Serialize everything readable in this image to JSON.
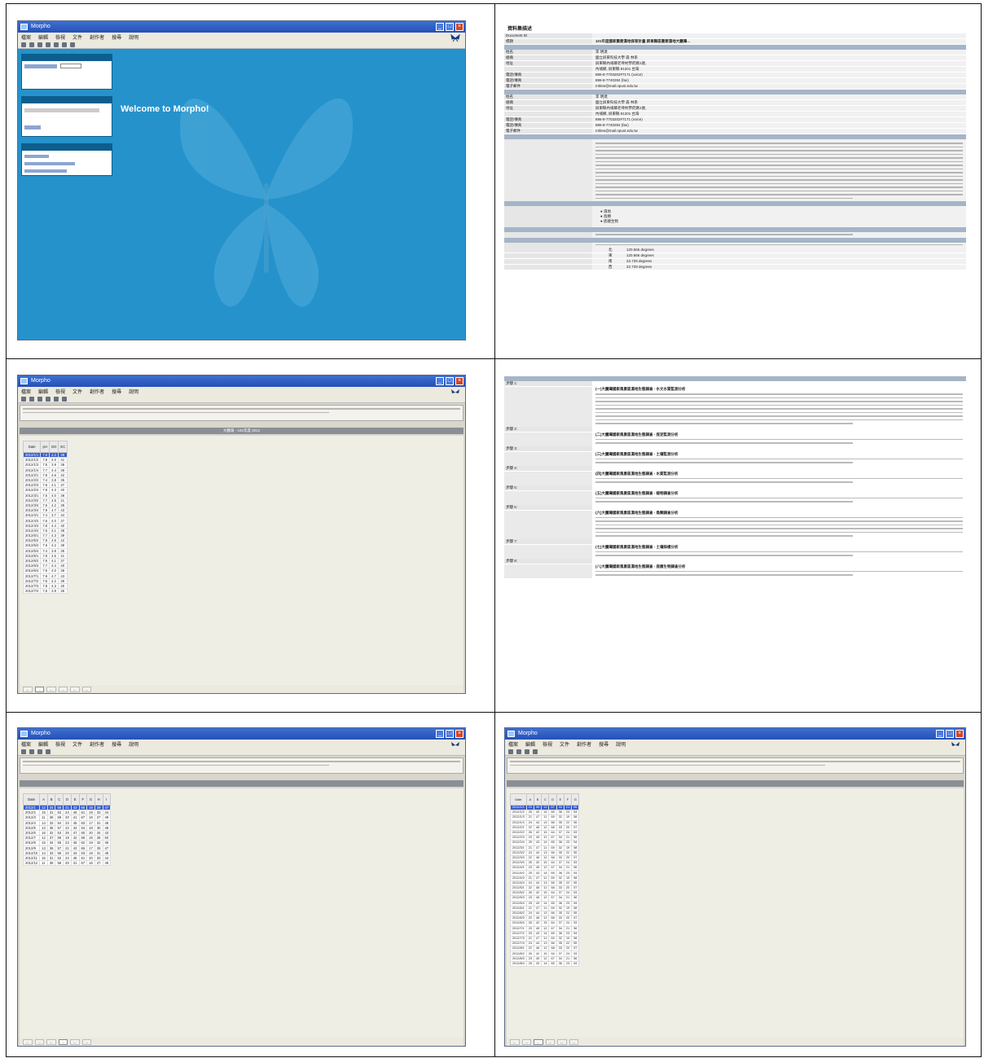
{
  "welcome": {
    "title": "Morpho",
    "menu": [
      "檔案",
      "編輯",
      "檢視",
      "文件",
      "創作者",
      "搜尋",
      "說明"
    ],
    "greeting": "Welcome to Morpho!",
    "panels": [
      {
        "header": "",
        "lines": [
          "",
          "",
          ""
        ]
      },
      {
        "header": "",
        "lines": [
          "",
          "",
          ""
        ]
      },
      {
        "header": "",
        "lines": [
          "",
          "",
          ""
        ]
      }
    ]
  },
  "doc1": {
    "title": "資料集描述",
    "fields": [
      {
        "k": "Document ID",
        "v": ""
      },
      {
        "k": "標題",
        "v": "101年度國家重要濕地保育計畫 屏東縣區重要濕地大鵬灣..."
      }
    ],
    "sections": [
      {
        "head": "",
        "rows": [
          {
            "k": "姓名",
            "v": "李 明達"
          },
          {
            "k": "組織",
            "v": "國立屏東科技大學 森 林系"
          },
          {
            "k": "地址",
            "v": "屏東縣內埔鄉老埤村學府路1號,"
          },
          {
            "k": "",
            "v": "內埔鄉, 屏東縣 91201 台灣"
          },
          {
            "k": "電話/傳真",
            "v": "886-8-7703202#7171 (voice)"
          },
          {
            "k": "電話/傳真",
            "v": "886-8-7740294 (fax)"
          },
          {
            "k": "電子郵件",
            "v": "mhlee@mail.npust.edu.tw"
          }
        ]
      },
      {
        "head": "",
        "rows": [
          {
            "k": "姓名",
            "v": "李 明達"
          },
          {
            "k": "組織",
            "v": "國立屏東科技大學 森 林系"
          },
          {
            "k": "地址",
            "v": "屏東縣內埔鄉老埤村學府路1號,"
          },
          {
            "k": "",
            "v": "內埔鄉, 屏東縣 91201 台灣"
          },
          {
            "k": "電話/傳真",
            "v": "886-8-7703202#7171 (voice)"
          },
          {
            "k": "電話/傳真",
            "v": "886-8-7740294 (fax)"
          },
          {
            "k": "電子郵件",
            "v": "mhlee@mail.npust.edu.tw"
          }
        ]
      }
    ],
    "keywords": [
      "濕地",
      "鳥類",
      "底棲生物"
    ],
    "coords": [
      {
        "k": "北",
        "v": "120.566 degrees"
      },
      {
        "k": "東",
        "v": "120.566 degrees"
      },
      {
        "k": "南",
        "v": "22.729 degrees"
      },
      {
        "k": "西",
        "v": "22.729 degrees"
      }
    ]
  },
  "doc2": {
    "steps": [
      {
        "k": "步驟 1:",
        "head": "(一)大鵬灣國家風景區濕地生態調查 - 水文水質監測分析"
      },
      {
        "k": "步驟 2:",
        "head": "(二)大鵬灣國家風景區濕地生態調查 - 底泥監測分析"
      },
      {
        "k": "步驟 3:",
        "head": "(三)大鵬灣國家風景區濕地生態調查 - 土壤監測分析"
      },
      {
        "k": "步驟 4:",
        "head": "(四)大鵬灣國家風景區濕地生態調查 - 水質監測分析"
      },
      {
        "k": "步驟 5:",
        "head": "(五)大鵬灣國家風景區濕地生態調查 - 植物調查分析"
      },
      {
        "k": "步驟 6:",
        "head": "(六)大鵬灣國家風景區濕地生態調查 - 鳥類調查分析"
      },
      {
        "k": "步驟 7:",
        "head": "(七)大鵬灣國家風景區濕地生態調查 - 土壤採樣分析"
      },
      {
        "k": "步驟 8:",
        "head": "(八)大鵬灣國家風景區濕地生態調查 - 底棲生物調查分析"
      }
    ]
  },
  "table1": {
    "title": "大鵬灣 - 101年度 2012",
    "cols": [
      "Date",
      "pH",
      "DO",
      "EC"
    ],
    "rows": [
      [
        "2012/1/1",
        "7.6",
        "4.2",
        "38"
      ],
      [
        "2012/1/2",
        "7.8",
        "4.0",
        "41"
      ],
      [
        "2012/1/3",
        "7.5",
        "3.9",
        "36"
      ],
      [
        "2012/1/4",
        "7.7",
        "4.4",
        "39"
      ],
      [
        "2012/2/1",
        "7.9",
        "4.6",
        "42"
      ],
      [
        "2012/2/2",
        "7.4",
        "3.8",
        "35"
      ],
      [
        "2012/2/3",
        "7.6",
        "4.1",
        "37"
      ],
      [
        "2012/2/4",
        "7.8",
        "4.3",
        "40"
      ],
      [
        "2012/3/1",
        "7.5",
        "4.0",
        "38"
      ],
      [
        "2012/3/2",
        "7.7",
        "4.5",
        "41"
      ],
      [
        "2012/3/3",
        "7.6",
        "4.2",
        "39"
      ],
      [
        "2012/3/4",
        "7.9",
        "4.7",
        "43"
      ],
      [
        "2012/4/1",
        "7.4",
        "3.7",
        "34"
      ],
      [
        "2012/4/2",
        "7.6",
        "4.0",
        "37"
      ],
      [
        "2012/4/3",
        "7.8",
        "4.4",
        "40"
      ],
      [
        "2012/4/4",
        "7.5",
        "4.1",
        "38"
      ],
      [
        "2012/5/1",
        "7.7",
        "4.3",
        "39"
      ],
      [
        "2012/5/2",
        "7.9",
        "4.6",
        "42"
      ],
      [
        "2012/5/3",
        "7.6",
        "4.2",
        "38"
      ],
      [
        "2012/5/4",
        "7.4",
        "3.9",
        "35"
      ],
      [
        "2012/6/1",
        "7.8",
        "4.5",
        "41"
      ],
      [
        "2012/6/2",
        "7.6",
        "4.1",
        "37"
      ],
      [
        "2012/6/3",
        "7.7",
        "4.4",
        "40"
      ],
      [
        "2012/6/4",
        "7.5",
        "4.0",
        "36"
      ],
      [
        "2012/7/1",
        "7.9",
        "4.7",
        "43"
      ],
      [
        "2012/7/2",
        "7.6",
        "4.2",
        "39"
      ],
      [
        "2012/7/3",
        "7.8",
        "4.3",
        "40"
      ],
      [
        "2012/7/4",
        "7.5",
        "3.9",
        "36"
      ]
    ]
  },
  "table2": {
    "cols": [
      "Date",
      "A",
      "B",
      "C",
      "D",
      "E",
      "F",
      "G",
      "H",
      "I"
    ],
    "rows": [
      [
        "2012/1",
        "12",
        "34",
        "56",
        "21",
        "43",
        "65",
        "18",
        "29",
        "47"
      ],
      [
        "2012/2",
        "15",
        "31",
        "52",
        "24",
        "46",
        "61",
        "19",
        "33",
        "44"
      ],
      [
        "2012/3",
        "11",
        "36",
        "58",
        "20",
        "41",
        "67",
        "16",
        "27",
        "49"
      ],
      [
        "2012/4",
        "14",
        "33",
        "54",
        "23",
        "45",
        "63",
        "17",
        "31",
        "46"
      ],
      [
        "2012/5",
        "13",
        "35",
        "57",
        "22",
        "44",
        "64",
        "18",
        "30",
        "48"
      ],
      [
        "2012/6",
        "16",
        "32",
        "53",
        "25",
        "47",
        "60",
        "20",
        "34",
        "43"
      ],
      [
        "2012/7",
        "12",
        "37",
        "59",
        "19",
        "42",
        "66",
        "15",
        "28",
        "50"
      ],
      [
        "2012/8",
        "15",
        "34",
        "55",
        "23",
        "45",
        "62",
        "19",
        "32",
        "45"
      ],
      [
        "2012/9",
        "13",
        "36",
        "57",
        "21",
        "43",
        "65",
        "17",
        "29",
        "47"
      ],
      [
        "2012/10",
        "14",
        "33",
        "56",
        "22",
        "44",
        "63",
        "18",
        "31",
        "46"
      ],
      [
        "2012/11",
        "16",
        "31",
        "52",
        "24",
        "46",
        "61",
        "20",
        "33",
        "44"
      ],
      [
        "2012/12",
        "11",
        "35",
        "58",
        "20",
        "41",
        "67",
        "16",
        "27",
        "49"
      ]
    ]
  },
  "table3": {
    "cols": [
      "Date",
      "A",
      "B",
      "C",
      "D",
      "E",
      "F",
      "G"
    ],
    "rows": [
      [
        "2012/1/1",
        "23",
        "45",
        "12",
        "67",
        "34",
        "21",
        "56"
      ],
      [
        "2012/1/2",
        "25",
        "43",
        "14",
        "65",
        "36",
        "23",
        "54"
      ],
      [
        "2012/1/3",
        "21",
        "47",
        "11",
        "69",
        "32",
        "19",
        "58"
      ],
      [
        "2012/1/4",
        "24",
        "44",
        "13",
        "66",
        "35",
        "22",
        "55"
      ],
      [
        "2012/2/1",
        "22",
        "46",
        "12",
        "68",
        "33",
        "20",
        "57"
      ],
      [
        "2012/2/2",
        "26",
        "42",
        "15",
        "64",
        "37",
        "24",
        "53"
      ],
      [
        "2012/2/3",
        "23",
        "45",
        "12",
        "67",
        "34",
        "21",
        "56"
      ],
      [
        "2012/2/4",
        "25",
        "43",
        "14",
        "65",
        "36",
        "23",
        "54"
      ],
      [
        "2012/3/1",
        "21",
        "47",
        "11",
        "69",
        "32",
        "19",
        "58"
      ],
      [
        "2012/3/2",
        "24",
        "44",
        "13",
        "66",
        "35",
        "22",
        "55"
      ],
      [
        "2012/3/3",
        "22",
        "46",
        "12",
        "68",
        "33",
        "20",
        "57"
      ],
      [
        "2012/3/4",
        "26",
        "42",
        "15",
        "64",
        "37",
        "24",
        "53"
      ],
      [
        "2012/4/1",
        "23",
        "45",
        "12",
        "67",
        "34",
        "21",
        "56"
      ],
      [
        "2012/4/2",
        "25",
        "43",
        "14",
        "65",
        "36",
        "23",
        "54"
      ],
      [
        "2012/4/3",
        "21",
        "47",
        "11",
        "69",
        "32",
        "19",
        "58"
      ],
      [
        "2012/4/4",
        "24",
        "44",
        "13",
        "66",
        "35",
        "22",
        "55"
      ],
      [
        "2012/5/1",
        "22",
        "46",
        "12",
        "68",
        "33",
        "20",
        "57"
      ],
      [
        "2012/5/2",
        "26",
        "42",
        "15",
        "64",
        "37",
        "24",
        "53"
      ],
      [
        "2012/5/3",
        "23",
        "45",
        "12",
        "67",
        "34",
        "21",
        "56"
      ],
      [
        "2012/5/4",
        "25",
        "43",
        "14",
        "65",
        "36",
        "23",
        "54"
      ],
      [
        "2012/6/1",
        "21",
        "47",
        "11",
        "69",
        "32",
        "19",
        "58"
      ],
      [
        "2012/6/2",
        "24",
        "44",
        "13",
        "66",
        "35",
        "22",
        "55"
      ],
      [
        "2012/6/3",
        "22",
        "46",
        "12",
        "68",
        "33",
        "20",
        "57"
      ],
      [
        "2012/6/4",
        "26",
        "42",
        "15",
        "64",
        "37",
        "24",
        "53"
      ],
      [
        "2012/7/1",
        "23",
        "45",
        "12",
        "67",
        "34",
        "21",
        "56"
      ],
      [
        "2012/7/2",
        "25",
        "43",
        "14",
        "65",
        "36",
        "23",
        "54"
      ],
      [
        "2012/7/3",
        "21",
        "47",
        "11",
        "69",
        "32",
        "19",
        "58"
      ],
      [
        "2012/7/4",
        "24",
        "44",
        "13",
        "66",
        "35",
        "22",
        "55"
      ],
      [
        "2012/8/1",
        "22",
        "46",
        "12",
        "68",
        "33",
        "20",
        "57"
      ],
      [
        "2012/8/2",
        "26",
        "42",
        "15",
        "64",
        "37",
        "24",
        "53"
      ],
      [
        "2012/8/3",
        "23",
        "45",
        "12",
        "67",
        "34",
        "21",
        "56"
      ],
      [
        "2012/8/4",
        "25",
        "43",
        "14",
        "65",
        "36",
        "23",
        "54"
      ]
    ]
  },
  "tabs": [
    "...",
    "...",
    "...",
    "...",
    "...",
    "..."
  ]
}
